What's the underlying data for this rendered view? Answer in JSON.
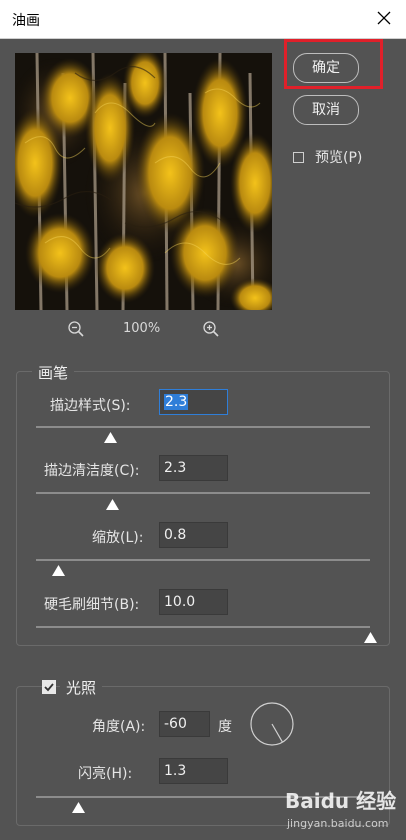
{
  "window": {
    "title": "油画"
  },
  "buttons": {
    "ok_label": "确定",
    "cancel_label": "取消"
  },
  "preview_option": {
    "label": "预览(P)",
    "checked": false
  },
  "zoom": {
    "level": "100%"
  },
  "brush": {
    "legend": "画笔",
    "stylization": {
      "label": "描边样式(S):",
      "value": "2.3",
      "slider_fraction": 0.22
    },
    "cleanliness": {
      "label": "描边清洁度(C):",
      "value": "2.3",
      "slider_fraction": 0.23
    },
    "scale": {
      "label": "缩放(L):",
      "value": "0.8",
      "slider_fraction": 0.07
    },
    "bristle_detail": {
      "label": "硬毛刷细节(B):",
      "value": "10.0",
      "slider_fraction": 1.0
    }
  },
  "lighting": {
    "legend": "光照",
    "checked": true,
    "angle": {
      "label": "角度(A):",
      "value": "-60",
      "unit": "度"
    },
    "shine": {
      "label": "闪亮(H):",
      "value": "1.3",
      "slider_fraction": 0.13
    }
  },
  "watermark": {
    "text": "Baidu 经验",
    "url": "jingyan.baidu.com"
  },
  "colors": {
    "accent_highlight": "#e0202a",
    "selection": "#2f7ed8",
    "background": "#535353"
  }
}
